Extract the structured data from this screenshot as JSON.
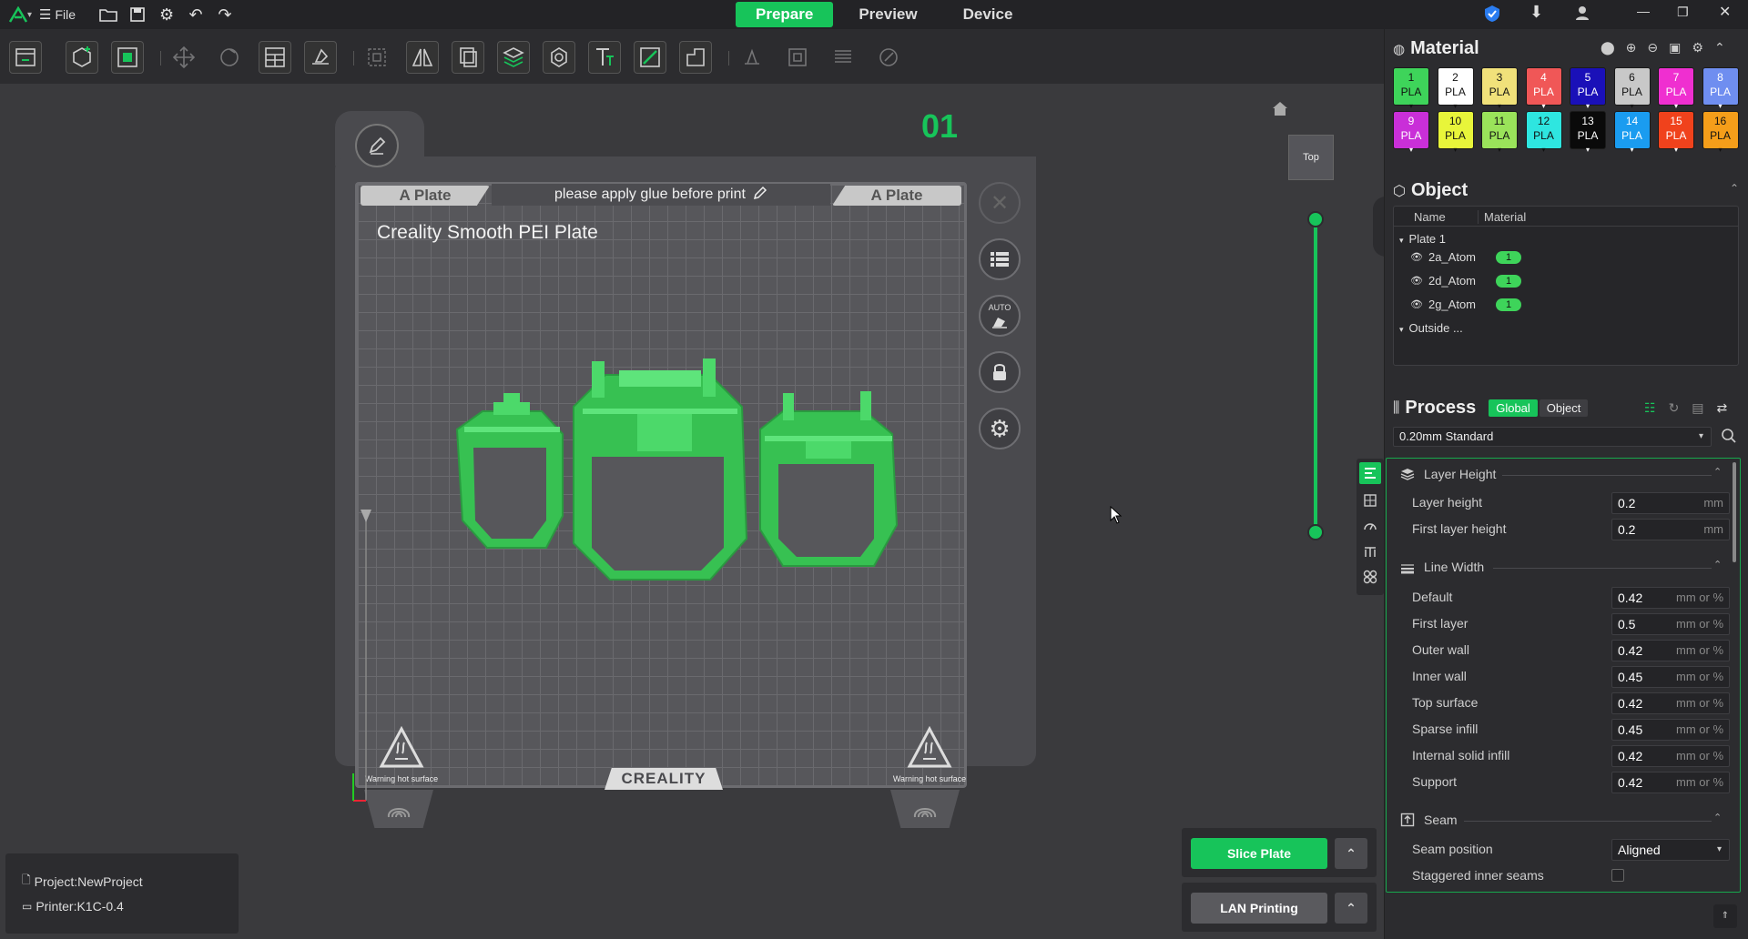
{
  "topbar": {
    "file_label": "File",
    "tabs": [
      "Prepare",
      "Preview",
      "Device"
    ]
  },
  "plate": {
    "number": "01",
    "left_tab": "A Plate",
    "right_tab": "A Plate",
    "note": "please apply glue before print",
    "bed_name": "Creality Smooth PEI Plate",
    "brand": "CREALITY",
    "warning_left": "Warning hot surface",
    "warning_right": "Warning hot surface",
    "auto_label": "AUTO"
  },
  "view": {
    "top_label": "Top"
  },
  "material": {
    "title": "Material",
    "slots": [
      {
        "n": "1",
        "t": "PLA",
        "color": "#3ed45a",
        "fg": "#111"
      },
      {
        "n": "2",
        "t": "PLA",
        "color": "#ffffff",
        "fg": "#111"
      },
      {
        "n": "3",
        "t": "PLA",
        "color": "#f1e17a",
        "fg": "#111"
      },
      {
        "n": "4",
        "t": "PLA",
        "color": "#f05757",
        "fg": "#fff"
      },
      {
        "n": "5",
        "t": "PLA",
        "color": "#1a10b8",
        "fg": "#fff"
      },
      {
        "n": "6",
        "t": "PLA",
        "color": "#c8c8c8",
        "fg": "#111"
      },
      {
        "n": "7",
        "t": "PLA",
        "color": "#ef2fd0",
        "fg": "#fff"
      },
      {
        "n": "8",
        "t": "PLA",
        "color": "#6f8ef0",
        "fg": "#fff"
      },
      {
        "n": "9",
        "t": "PLA",
        "color": "#c92fd8",
        "fg": "#fff"
      },
      {
        "n": "10",
        "t": "PLA",
        "color": "#e8f53a",
        "fg": "#111"
      },
      {
        "n": "11",
        "t": "PLA",
        "color": "#9ae35a",
        "fg": "#111"
      },
      {
        "n": "12",
        "t": "PLA",
        "color": "#2ee6e0",
        "fg": "#111"
      },
      {
        "n": "13",
        "t": "PLA",
        "color": "#0a0a0a",
        "fg": "#fff"
      },
      {
        "n": "14",
        "t": "PLA",
        "color": "#1a9cf0",
        "fg": "#fff"
      },
      {
        "n": "15",
        "t": "PLA",
        "color": "#f0421c",
        "fg": "#fff"
      },
      {
        "n": "16",
        "t": "PLA",
        "color": "#f59e1a",
        "fg": "#111"
      }
    ]
  },
  "object": {
    "title": "Object",
    "col_name": "Name",
    "col_material": "Material",
    "plate": "Plate 1",
    "items": [
      {
        "name": "2a_Atom",
        "mat": "1"
      },
      {
        "name": "2d_Atom",
        "mat": "1"
      },
      {
        "name": "2g_Atom",
        "mat": "1"
      }
    ],
    "outside": "Outside ..."
  },
  "process": {
    "title": "Process",
    "tab_global": "Global",
    "tab_object": "Object",
    "preset": "0.20mm Standard",
    "groups": {
      "layer_height": {
        "title": "Layer Height",
        "rows": [
          {
            "label": "Layer height",
            "value": "0.2",
            "unit": "mm"
          },
          {
            "label": "First layer height",
            "value": "0.2",
            "unit": "mm"
          }
        ]
      },
      "line_width": {
        "title": "Line Width",
        "rows": [
          {
            "label": "Default",
            "value": "0.42",
            "unit": "mm or %"
          },
          {
            "label": "First layer",
            "value": "0.5",
            "unit": "mm or %"
          },
          {
            "label": "Outer wall",
            "value": "0.42",
            "unit": "mm or %"
          },
          {
            "label": "Inner wall",
            "value": "0.45",
            "unit": "mm or %"
          },
          {
            "label": "Top surface",
            "value": "0.42",
            "unit": "mm or %"
          },
          {
            "label": "Sparse infill",
            "value": "0.45",
            "unit": "mm or %"
          },
          {
            "label": "Internal solid infill",
            "value": "0.42",
            "unit": "mm or %"
          },
          {
            "label": "Support",
            "value": "0.42",
            "unit": "mm or %"
          }
        ]
      },
      "seam": {
        "title": "Seam",
        "position_label": "Seam position",
        "position_value": "Aligned",
        "staggered_label": "Staggered inner seams"
      }
    }
  },
  "actions": {
    "slice": "Slice Plate",
    "lan": "LAN Printing"
  },
  "status": {
    "project": "Project:NewProject",
    "printer": "Printer:K1C-0.4"
  },
  "colors": {
    "accent": "#17c45a",
    "model": "#3fd25c"
  }
}
